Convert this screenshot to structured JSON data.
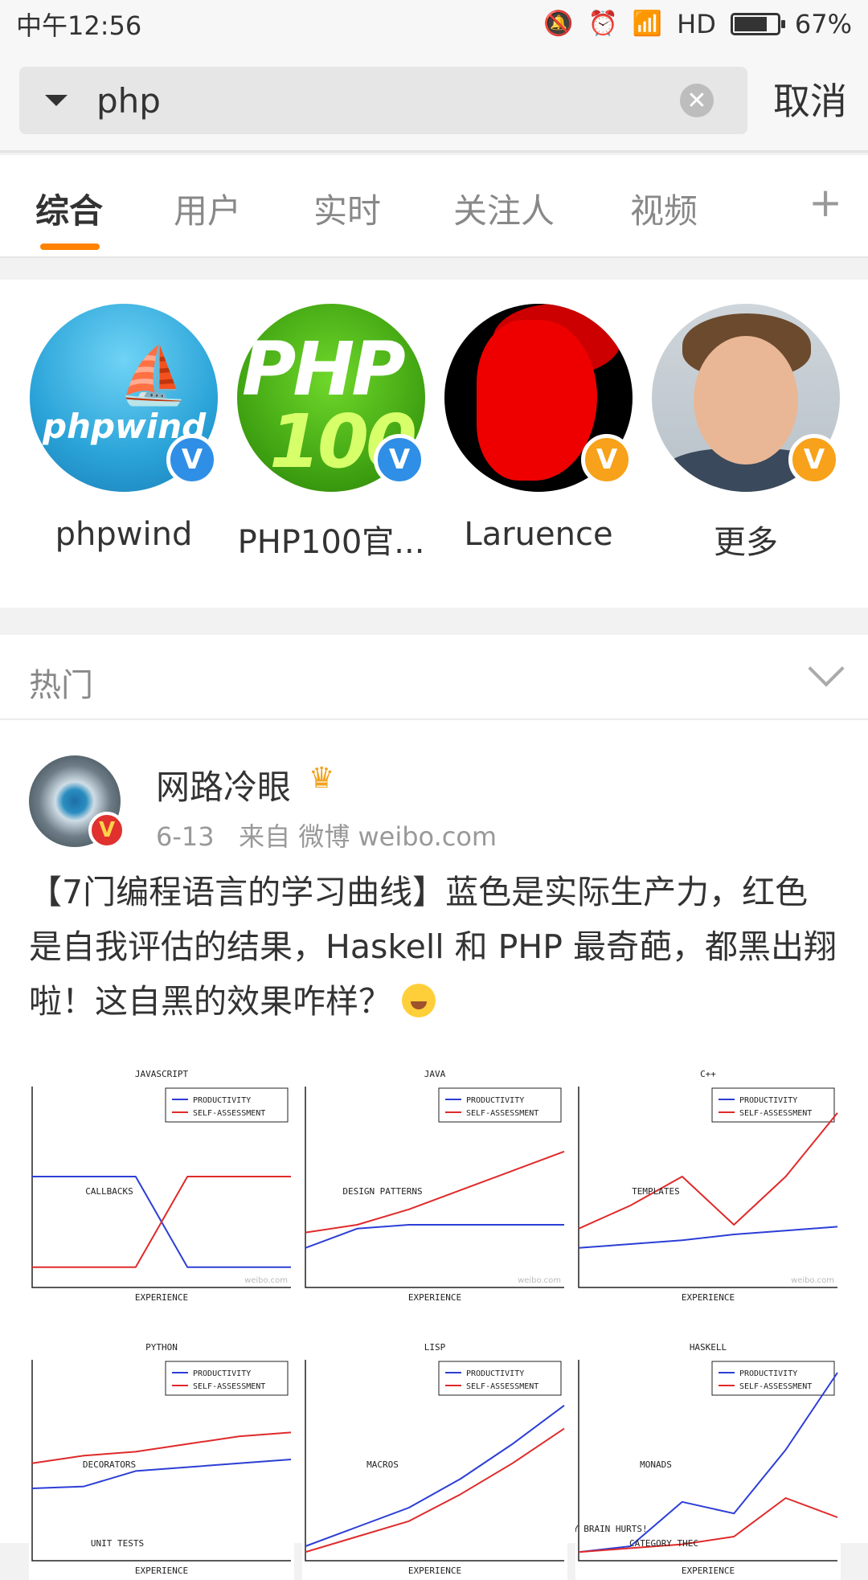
{
  "status_bar": {
    "time": "中午12:56",
    "network": "HD",
    "battery_percent": "67%"
  },
  "search": {
    "query": "php",
    "cancel_label": "取消"
  },
  "tabs": [
    {
      "label": "综合",
      "active": true
    },
    {
      "label": "用户"
    },
    {
      "label": "实时"
    },
    {
      "label": "关注人"
    },
    {
      "label": "视频"
    }
  ],
  "tabs_more": "+",
  "users": [
    {
      "name": "phpwind",
      "avatar_text": "phpwind",
      "badge": "V"
    },
    {
      "name": "PHP100官...",
      "avatar_text_top": "PHP",
      "avatar_text_bottom": "100",
      "badge": "V"
    },
    {
      "name": "Laruence",
      "badge": "V"
    },
    {
      "name": "更多",
      "badge": "V"
    }
  ],
  "section": {
    "title": "热门"
  },
  "post": {
    "author": "网路冷眼",
    "date": "6-13",
    "source": "来自 微博 weibo.com",
    "text": "【7门编程语言的学习曲线】蓝色是实际生产力，红色是自我评估的结果，Haskell 和 PHP 最奇葩，都黑出翔啦！这自黑的效果咋样？"
  },
  "chart_data": [
    {
      "type": "line",
      "title": "JAVASCRIPT",
      "xlabel": "EXPERIENCE",
      "legend": [
        "PRODUCTIVITY",
        "SELF-ASSESSMENT"
      ],
      "annotation": "CALLBACKS",
      "watermark": "weibo.com",
      "series": [
        {
          "name": "PRODUCTIVITY",
          "values": [
            0.55,
            0.55,
            0.55,
            0.08,
            0.08,
            0.08
          ]
        },
        {
          "name": "SELF-ASSESSMENT",
          "values": [
            0.08,
            0.08,
            0.08,
            0.55,
            0.55,
            0.55
          ]
        }
      ]
    },
    {
      "type": "line",
      "title": "JAVA",
      "xlabel": "EXPERIENCE",
      "legend": [
        "PRODUCTIVITY",
        "SELF-ASSESSMENT"
      ],
      "annotation": "DESIGN PATTERNS",
      "watermark": "weibo.com",
      "series": [
        {
          "name": "PRODUCTIVITY",
          "values": [
            0.18,
            0.28,
            0.3,
            0.3,
            0.3,
            0.3
          ]
        },
        {
          "name": "SELF-ASSESSMENT",
          "values": [
            0.26,
            0.3,
            0.38,
            0.48,
            0.58,
            0.68
          ]
        }
      ]
    },
    {
      "type": "line",
      "title": "C++",
      "xlabel": "EXPERIENCE",
      "legend": [
        "PRODUCTIVITY",
        "SELF-ASSESSMENT"
      ],
      "annotation": "TEMPLATES",
      "watermark": "weibo.com",
      "series": [
        {
          "name": "PRODUCTIVITY",
          "values": [
            0.18,
            0.2,
            0.22,
            0.25,
            0.27,
            0.29
          ]
        },
        {
          "name": "SELF-ASSESSMENT",
          "values": [
            0.28,
            0.4,
            0.55,
            0.3,
            0.55,
            0.88
          ]
        }
      ]
    },
    {
      "type": "line",
      "title": "PYTHON",
      "xlabel": "EXPERIENCE",
      "legend": [
        "PRODUCTIVITY",
        "SELF-ASSESSMENT"
      ],
      "annotation": "DECORATORS",
      "annotation2": "UNIT TESTS",
      "series": [
        {
          "name": "PRODUCTIVITY",
          "values": [
            0.35,
            0.36,
            0.44,
            0.46,
            0.48,
            0.5
          ]
        },
        {
          "name": "SELF-ASSESSMENT",
          "values": [
            0.48,
            0.52,
            0.54,
            0.58,
            0.62,
            0.64
          ]
        }
      ]
    },
    {
      "type": "line",
      "title": "LISP",
      "xlabel": "EXPERIENCE",
      "legend": [
        "PRODUCTIVITY",
        "SELF-ASSESSMENT"
      ],
      "annotation": "MACROS",
      "series": [
        {
          "name": "PRODUCTIVITY",
          "values": [
            0.05,
            0.15,
            0.25,
            0.4,
            0.58,
            0.78
          ]
        },
        {
          "name": "SELF-ASSESSMENT",
          "values": [
            0.02,
            0.1,
            0.18,
            0.32,
            0.48,
            0.66
          ]
        }
      ]
    },
    {
      "type": "line",
      "title": "HASKELL",
      "xlabel": "EXPERIENCE",
      "legend": [
        "PRODUCTIVITY",
        "SELF-ASSESSMENT"
      ],
      "annotation": "MONADS",
      "annotation2": "CATEGORY THEC",
      "annotation3": "MY BRAIN HURTS!",
      "series": [
        {
          "name": "PRODUCTIVITY",
          "values": [
            0.02,
            0.05,
            0.28,
            0.22,
            0.55,
            0.95
          ]
        },
        {
          "name": "SELF-ASSESSMENT",
          "values": [
            0.02,
            0.04,
            0.06,
            0.1,
            0.3,
            0.2
          ]
        }
      ]
    }
  ],
  "colors": {
    "accent": "#ff8200",
    "productivity": "#2c3ed6",
    "self_assessment": "#e02a2a",
    "verified_blue": "#2f8fe6",
    "verified_gold": "#f7a21a"
  }
}
